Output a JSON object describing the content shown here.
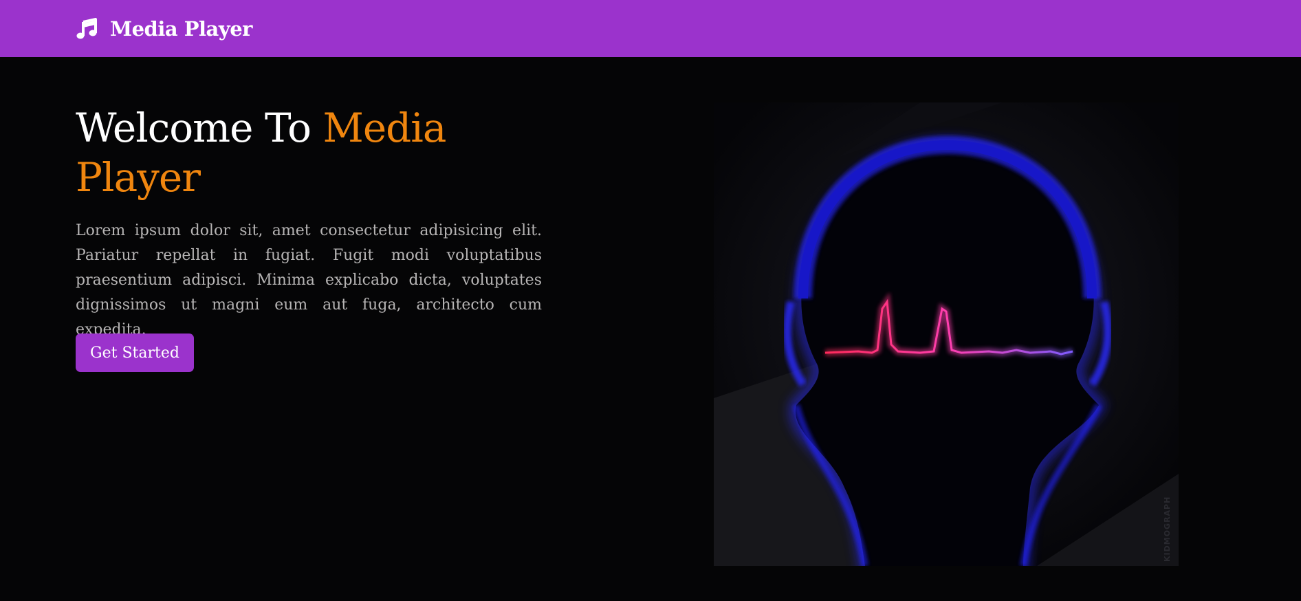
{
  "navbar": {
    "brand_name": "Media Player",
    "brand_icon": "music-note-icon",
    "background": "#9b33cc"
  },
  "hero": {
    "title_part1": "Welcome To ",
    "title_part2": "Media Player",
    "title_color": "#ffffff",
    "accent_color": "#f0860f",
    "description": "Lorem ipsum dolor sit, amet consectetur adipisicing elit. Pariatur repellat in fugiat. Fugit modi voluptatibus praesentium adipisci. Minima explicabo dicta, voluptates dignissimos ut magni eum aut fuga, architecto cum expedita.",
    "cta_label": "Get Started",
    "image_subject": "headphones-silhouette-waveform",
    "image_watermark": "KIDMOGRAPH"
  },
  "colors": {
    "page_background": "#050506",
    "text_muted": "#b7b5b5",
    "primary": "#9b33cc"
  }
}
